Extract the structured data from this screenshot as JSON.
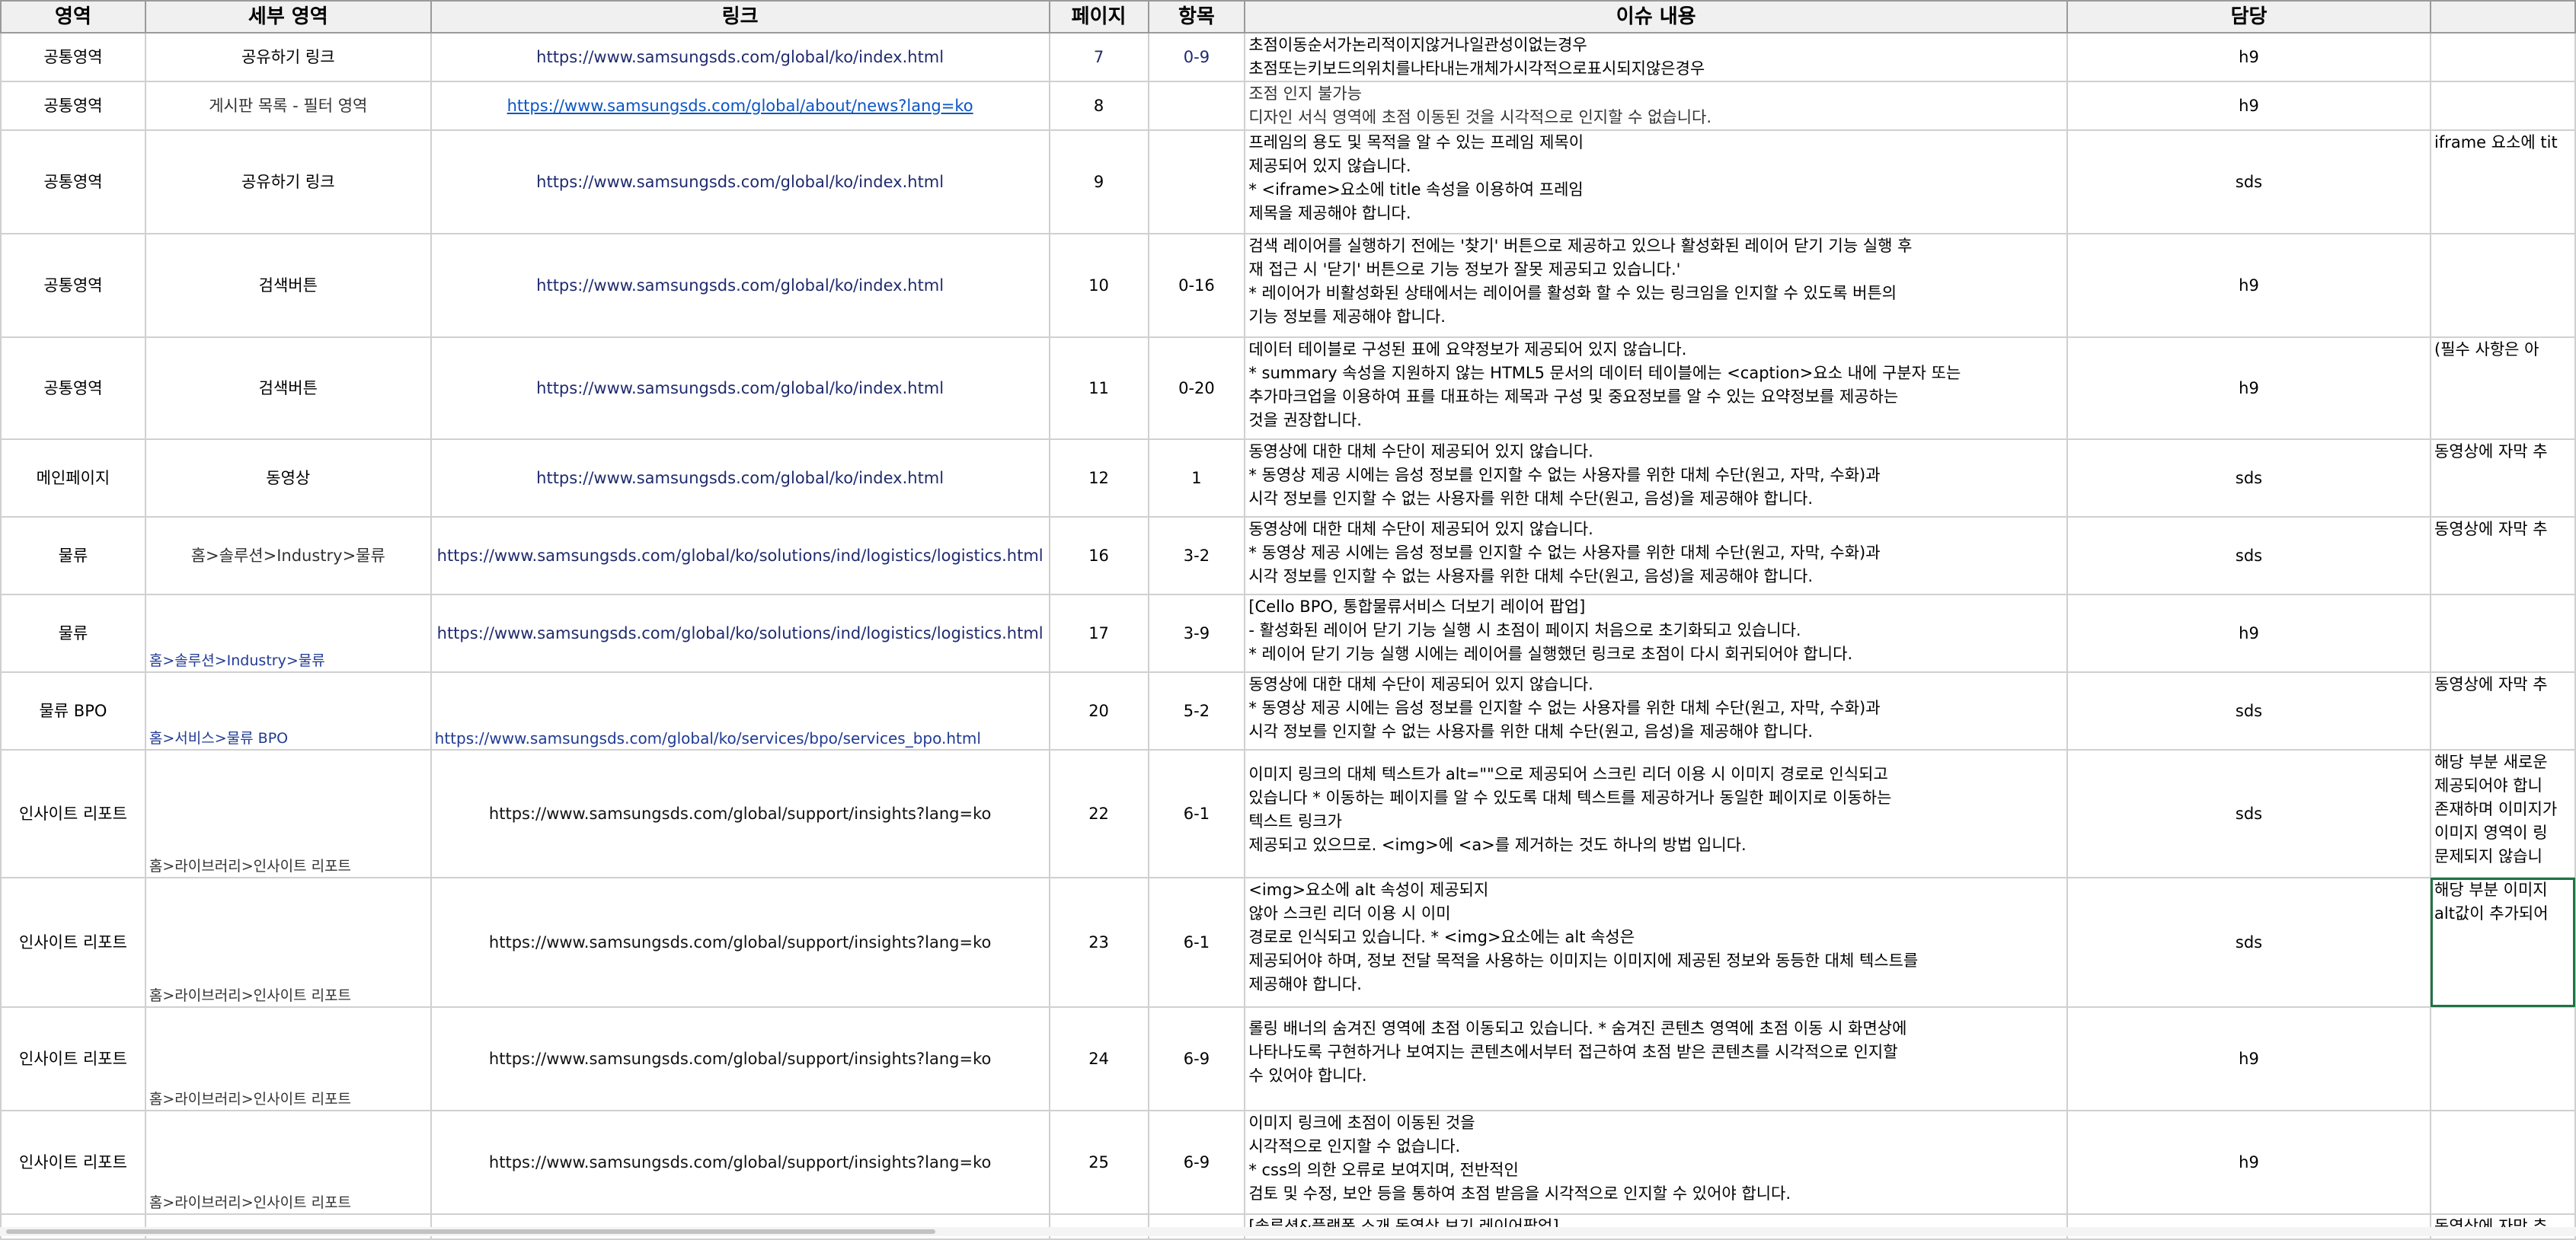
{
  "headers": {
    "area": "영역",
    "subarea": "세부 영역",
    "link": "링크",
    "page": "페이지",
    "item": "항목",
    "issue": "이슈 내용",
    "owner": "담당",
    "extra": ""
  },
  "rows": [
    {
      "area": "공통영역",
      "subarea": "공유하기 링크",
      "subarea_corner": "",
      "link": "https://www.samsungsds.com/global/ko/index.html",
      "link_corner": "",
      "page": "7",
      "item": "0-9",
      "issue": [
        "초점이동순서가논리적이지않거나일관성이없는경우",
        "초점또는키보드의위치를나타내는개체가시각적으로표시되지않은경우"
      ],
      "owner": "h9",
      "extra": [
        ""
      ]
    },
    {
      "area": "공통영역",
      "subarea": "게시판 목록 - 필터 영역",
      "subarea_corner": "",
      "link": "https://www.samsungsds.com/global/about/news?lang=ko",
      "link_corner": "",
      "page": "8",
      "item": "",
      "issue": [
        "조점 인지 불가능",
        "디자인 서식 영역에 초점 이동된 것을 시각적으로 인지할 수 없습니다."
      ],
      "owner": "h9",
      "extra": [
        ""
      ]
    },
    {
      "area": "공통영역",
      "subarea": "공유하기 링크",
      "subarea_corner": "",
      "link": "https://www.samsungsds.com/global/ko/index.html",
      "link_corner": "",
      "page": "9",
      "item": "",
      "issue": [
        "프레임의 용도 및 목적을 알 수 있는 프레임 제목이",
        "제공되어 있지 않습니다.",
        "* <iframe>요소에 title 속성을 이용하여 프레임",
        "제목을 제공해야 합니다."
      ],
      "owner": "sds",
      "extra": [
        "iframe 요소에 tit"
      ]
    },
    {
      "area": "공통영역",
      "subarea": "검색버튼",
      "subarea_corner": "",
      "link": "https://www.samsungsds.com/global/ko/index.html",
      "link_corner": "",
      "page": "10",
      "item": "0-16",
      "issue": [
        "검색 레이어를 실행하기 전에는 '찾기' 버튼으로 제공하고 있으나 활성화된 레이어 닫기 기능 실행 후",
        "재 접근 시 '닫기' 버튼으로 기능 정보가 잘못 제공되고 있습니다.'",
        "* 레이어가 비활성화된 상태에서는 레이어를 활성화 할 수 있는 링크임을 인지할 수 있도록 버튼의",
        "기능 정보를 제공해야 합니다."
      ],
      "owner": "h9",
      "extra": [
        ""
      ]
    },
    {
      "area": "공통영역",
      "subarea": "검색버튼",
      "subarea_corner": "",
      "link": "https://www.samsungsds.com/global/ko/index.html",
      "link_corner": "",
      "page": "11",
      "item": "0-20",
      "issue": [
        "데이터 테이블로 구성된 표에 요약정보가 제공되어 있지 않습니다.",
        "* summary 속성을 지원하지 않는 HTML5 문서의 데이터 테이블에는 <caption>요소 내에 구분자 또는",
        "추가마크업을 이용하여 표를 대표하는 제목과 구성 및 중요정보를 알 수 있는 요약정보를 제공하는",
        "것을 권장합니다."
      ],
      "owner": "h9",
      "extra": [
        "(필수 사항은 아"
      ]
    },
    {
      "area": "메인페이지",
      "subarea": "동영상",
      "subarea_corner": "",
      "link": "https://www.samsungsds.com/global/ko/index.html",
      "link_corner": "",
      "page": "12",
      "item": "1",
      "issue": [
        "동영상에 대한 대체 수단이 제공되어 있지 않습니다.",
        "* 동영상 제공 시에는 음성 정보를 인지할 수 없는 사용자를 위한 대체 수단(원고, 자막, 수화)과",
        "시각 정보를 인지할 수 없는 사용자를 위한 대체 수단(원고, 음성)을 제공해야 합니다."
      ],
      "owner": "sds",
      "extra": [
        "동영상에 자막 추"
      ]
    },
    {
      "area": "물류",
      "subarea": "홈>솔루션>Industry>물류",
      "subarea_corner": "",
      "link": "https://www.samsungsds.com/global/ko/solutions/ind/logistics/logistics.html",
      "link_corner": "",
      "page": "16",
      "item": "3-2",
      "issue": [
        "동영상에 대한 대체 수단이 제공되어 있지 않습니다.",
        "* 동영상 제공 시에는 음성 정보를 인지할 수 없는 사용자를 위한 대체 수단(원고, 자막, 수화)과",
        "시각 정보를 인지할 수 없는 사용자를 위한 대체 수단(원고, 음성)을 제공해야 합니다."
      ],
      "owner": "sds",
      "extra": [
        "동영상에 자막 추"
      ]
    },
    {
      "area": "물류",
      "subarea": "",
      "subarea_corner": "홈>솔루션>Industry>물류",
      "link": "https://www.samsungsds.com/global/ko/solutions/ind/logistics/logistics.html",
      "link_corner": "",
      "page": "17",
      "item": "3-9",
      "issue": [
        "[Cello BPO, 통합물류서비스 더보기 레이어 팝업]",
        "- 활성화된 레이어 닫기 기능 실행 시 초점이 페이지 처음으로 초기화되고 있습니다.",
        "* 레이어 닫기 기능 실행 시에는 레이어를 실행했던 링크로 초점이 다시 회귀되어야 합니다."
      ],
      "owner": "h9",
      "extra": [
        ""
      ]
    },
    {
      "area": "물류 BPO",
      "subarea": "",
      "subarea_corner": "홈>서비스>물류 BPO",
      "link": "",
      "link_corner": "https://www.samsungsds.com/global/ko/services/bpo/services_bpo.html",
      "page": "20",
      "item": "5-2",
      "issue": [
        "동영상에 대한 대체 수단이 제공되어 있지 않습니다.",
        "* 동영상 제공 시에는 음성 정보를 인지할 수 없는 사용자를 위한 대체 수단(원고, 자막, 수화)과",
        "시각 정보를 인지할 수 없는 사용자를 위한 대체 수단(원고, 음성)을 제공해야 합니다."
      ],
      "owner": "sds",
      "extra": [
        "동영상에 자막 추"
      ]
    },
    {
      "area": "인사이트 리포트",
      "subarea": "",
      "subarea_corner": "홈>라이브러리>인사이트 리포트",
      "link": "https://www.samsungsds.com/global/support/insights?lang=ko",
      "link_corner": "",
      "page": "22",
      "item": "6-1",
      "issue": [
        "이미지 링크의 대체 텍스트가 alt=\"\"으로 제공되어 스크린 리더 이용 시 이미지 경로로 인식되고",
        "있습니다 * 이동하는 페이지를 알 수 있도록 대체 텍스트를 제공하거나 동일한 페이지로 이동하는",
        "텍스트 링크가",
        "제공되고 있으므로. <img>에 <a>를 제거하는 것도 하나의 방법 입니다."
      ],
      "owner": "sds",
      "extra": [
        "해당 부분 새로운",
        "제공되어야 합니",
        "존재하며 이미지가",
        "이미지 영역이 링",
        "문제되지 않습니"
      ]
    },
    {
      "area": "인사이트 리포트",
      "subarea": "",
      "subarea_corner": "홈>라이브러리>인사이트 리포트",
      "link": "https://www.samsungsds.com/global/support/insights?lang=ko",
      "link_corner": "",
      "page": "23",
      "item": "6-1",
      "issue": [
        "<img>요소에 alt 속성이 제공되지",
        "않아 스크린 리더 이용 시 이미",
        "경로로 인식되고 있습니다. * <img>요소에는 alt 속성은",
        "제공되어야 하며, 정보 전달 목적을 사용하는 이미지는 이미지에 제공된 정보와 동등한 대체 텍스트를",
        "제공해야 합니다."
      ],
      "owner": "sds",
      "extra": [
        "해당 부분 이미지",
        "alt값이 추가되어"
      ]
    },
    {
      "area": "인사이트 리포트",
      "subarea": "",
      "subarea_corner": "홈>라이브러리>인사이트 리포트",
      "link": "https://www.samsungsds.com/global/support/insights?lang=ko",
      "link_corner": "",
      "page": "24",
      "item": "6-9",
      "issue": [
        "롤링 배너의 숨겨진 영역에 초점 이동되고 있습니다. * 숨겨진 콘텐츠 영역에 초점 이동 시 화면상에",
        "나타나도록 구현하거나 보여지는 콘텐츠에서부터 접근하여 초점 받은 콘텐츠를 시각적으로 인지할",
        "수 있어야 합니다."
      ],
      "owner": "h9",
      "extra": [
        ""
      ]
    },
    {
      "area": "인사이트 리포트",
      "subarea": "",
      "subarea_corner": "홈>라이브러리>인사이트 리포트",
      "link": "https://www.samsungsds.com/global/support/insights?lang=ko",
      "link_corner": "",
      "page": "25",
      "item": "6-9",
      "issue": [
        "이미지 링크에 초점이 이동된 것을",
        "시각적으로 인지할 수 없습니다.",
        "* css의 의한 오류로 보여지며, 전반적인",
        "검토 및 수정, 보안 등을 통하여 초점 받음을 시각적으로 인지할 수 있어야 합니다."
      ],
      "owner": "h9",
      "extra": [
        ""
      ]
    },
    {
      "area": "",
      "subarea": "",
      "subarea_corner": "",
      "link": "",
      "link_corner": "",
      "page": "",
      "item": "",
      "issue": [
        "[솔루션&플랫폼 소개 동영상 보기 레이어팝업]"
      ],
      "owner": "",
      "extra": [
        "동영상에 자막 추"
      ]
    }
  ]
}
